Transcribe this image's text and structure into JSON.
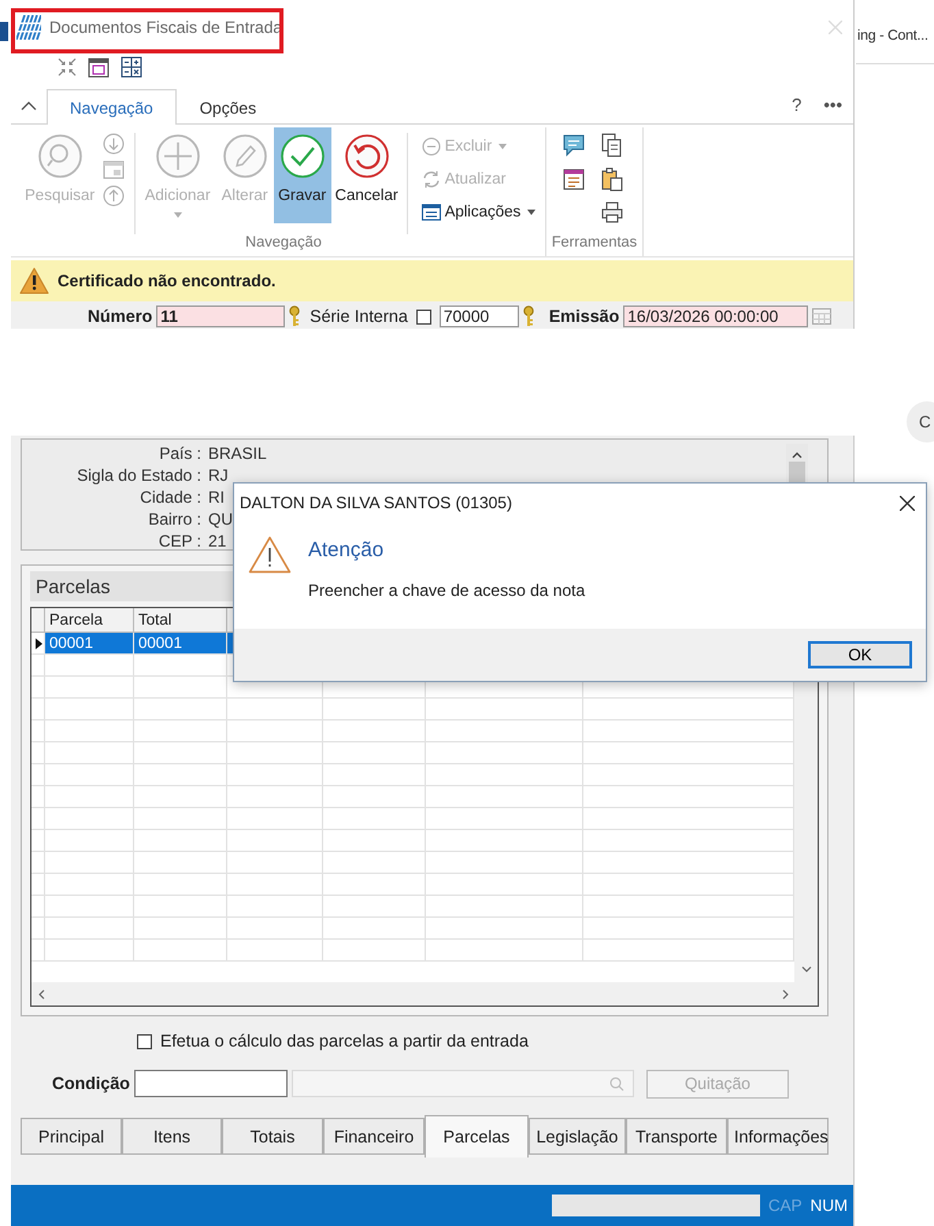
{
  "background_window": {
    "title_fragment": "ing - Cont...",
    "badge": "C"
  },
  "window": {
    "title": "Documentos Fiscais de Entrada",
    "highlighted": true
  },
  "ribbon": {
    "tabs": [
      {
        "label": "Navegação",
        "selected": true
      },
      {
        "label": "Opções",
        "selected": false
      }
    ],
    "help": "?",
    "more": "•••",
    "large_buttons": [
      {
        "label": "Pesquisar",
        "disabled": true,
        "selected": false,
        "dropdown": false
      },
      {
        "label": "Adicionar",
        "disabled": true,
        "selected": false,
        "dropdown": true
      },
      {
        "label": "Alterar",
        "disabled": true,
        "selected": false,
        "dropdown": false
      },
      {
        "label": "Gravar",
        "disabled": false,
        "selected": true,
        "dropdown": false
      },
      {
        "label": "Cancelar",
        "disabled": false,
        "selected": false,
        "dropdown": false
      }
    ],
    "small_buttons": [
      {
        "label": "Excluir",
        "disabled": true,
        "dropdown": true
      },
      {
        "label": "Atualizar",
        "disabled": true,
        "dropdown": false
      },
      {
        "label": "Aplicações",
        "disabled": false,
        "dropdown": true
      }
    ],
    "groups": [
      "Navegação",
      "Ferramentas"
    ]
  },
  "warning": {
    "message": "Certificado não encontrado."
  },
  "header_fields": {
    "numero": {
      "label": "Número",
      "value": "11"
    },
    "serie": {
      "label": "Série Interna",
      "checked": false,
      "value": "70000"
    },
    "emissao": {
      "label": "Emissão",
      "value": "16/03/2026 00:00:00"
    }
  },
  "address": [
    {
      "label": "País :",
      "value": "BRASIL"
    },
    {
      "label": "Sigla do Estado :",
      "value": "RJ"
    },
    {
      "label": "Cidade :",
      "value": "RI"
    },
    {
      "label": "Bairro :",
      "value": "QU"
    },
    {
      "label": "CEP :",
      "value": "21"
    }
  ],
  "parcelas": {
    "title": "Parcelas",
    "columns": [
      "Parcela",
      "Total"
    ],
    "rows": [
      {
        "cells": [
          "00001",
          "00001"
        ],
        "selected": true
      }
    ]
  },
  "calc_option": {
    "label": "Efetua o cálculo das parcelas a partir da entrada",
    "checked": false
  },
  "condicao": {
    "label": "Condição",
    "button": "Quitação",
    "button_disabled": true
  },
  "bottom_tabs": [
    {
      "label": "Principal",
      "selected": false
    },
    {
      "label": "Itens",
      "selected": false
    },
    {
      "label": "Totais",
      "selected": false
    },
    {
      "label": "Financeiro",
      "selected": false
    },
    {
      "label": "Parcelas",
      "selected": true
    },
    {
      "label": "Legislação",
      "selected": false
    },
    {
      "label": "Transporte",
      "selected": false
    },
    {
      "label": "Informações",
      "selected": false
    }
  ],
  "status_bar": {
    "indicators": [
      {
        "label": "CAP",
        "on": false
      },
      {
        "label": "NUM",
        "on": true
      }
    ]
  },
  "dialog": {
    "title": "DALTON DA SILVA SANTOS (01305)",
    "heading": "Atenção",
    "message": "Preencher a chave de acesso da nota",
    "button": "OK"
  }
}
